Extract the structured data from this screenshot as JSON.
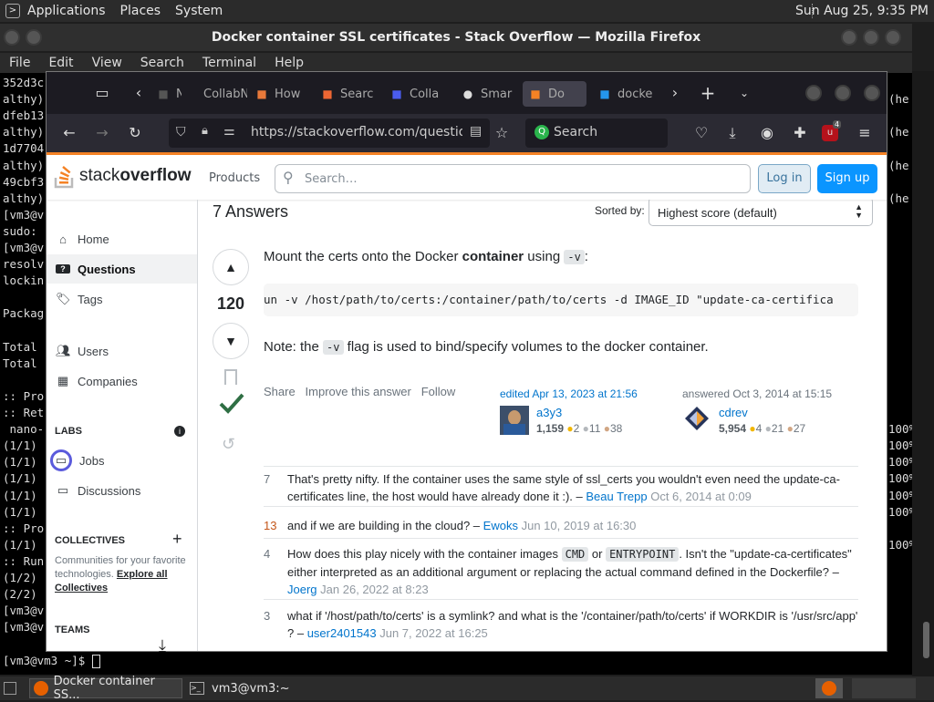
{
  "top_panel": {
    "menus": [
      "Applications",
      "Places",
      "System"
    ],
    "clock": "Sun Aug 25,  9:35 PM"
  },
  "terminal": {
    "title": "Docker container SSL certificates - Stack Overflow — Mozilla Firefox",
    "menu": [
      "File",
      "Edit",
      "View",
      "Search",
      "Terminal",
      "Help"
    ],
    "left_lines": [
      "352d3c",
      "althy)",
      "dfeb13",
      "althy)",
      "1d7704",
      "althy)",
      "49cbf3",
      "althy)",
      "[vm3@v",
      "sudo:",
      "[vm3@v",
      "resolv",
      "lockin",
      "",
      "Packag",
      "",
      "Total",
      "Total",
      "",
      ":: Pro",
      ":: Ret",
      " nano-",
      "(1/1)",
      "(1/1)",
      "(1/1)",
      "(1/1)",
      "(1/1)",
      ":: Pro",
      "(1/1)",
      ":: Run",
      "(1/2)",
      "(2/2)",
      "[vm3@v",
      "[vm3@v"
    ],
    "right_lines": [
      {
        "row": 1,
        "text": "(he"
      },
      {
        "row": 3,
        "text": "(he"
      },
      {
        "row": 5,
        "text": "(he"
      },
      {
        "row": 7,
        "text": "(he"
      },
      {
        "row": 21,
        "text": "100%"
      },
      {
        "row": 22,
        "text": "100%"
      },
      {
        "row": 23,
        "text": "100%"
      },
      {
        "row": 24,
        "text": "100%"
      },
      {
        "row": 25,
        "text": "100%"
      },
      {
        "row": 26,
        "text": "100%"
      },
      {
        "row": 28,
        "text": "100%"
      }
    ],
    "prompt": "[vm3@vm3 ~]$ "
  },
  "firefox": {
    "tabs": [
      {
        "label": "Ne",
        "icon": "blank-icon"
      },
      {
        "label": "CollabNe",
        "icon": "collabnet-icon"
      },
      {
        "label": "How",
        "icon": "howto-icon"
      },
      {
        "label": "Searc",
        "icon": "search-flower-icon"
      },
      {
        "label": "Colla",
        "icon": "collab-q-icon"
      },
      {
        "label": "Smar",
        "icon": "github-icon"
      },
      {
        "label": "Do",
        "icon": "stackoverflow-icon",
        "active": true
      },
      {
        "label": "docke",
        "icon": "docker-icon"
      }
    ],
    "url": "https://stackoverflow.com/questions",
    "search_placeholder": "Search",
    "badge_count": "4"
  },
  "so": {
    "logo_text_light": "stack",
    "logo_text_bold": "overflow",
    "products": "Products",
    "search_placeholder": "Search…",
    "login": "Log in",
    "signup": "Sign up",
    "sidebar": {
      "home": "Home",
      "questions": "Questions",
      "tags": "Tags",
      "users": "Users",
      "companies": "Companies",
      "labs_heading": "LABS",
      "jobs": "Jobs",
      "discussions": "Discussions",
      "collectives_heading": "COLLECTIVES",
      "collectives_desc": "Communities for your favorite technologies.",
      "collectives_link": "Explore all Collectives",
      "teams_heading": "TEAMS"
    },
    "answers_count": "7 Answers",
    "sorted_by_label": "Sorted by:",
    "sort_value": "Highest score (default)",
    "answer": {
      "score": "120",
      "intro_before": "Mount the certs onto the Docker ",
      "intro_bold": "container",
      "intro_after": " using ",
      "intro_code": "-v",
      "intro_end": ":",
      "code_block": "un -v /host/path/to/certs:/container/path/to/certs -d IMAGE_ID \"update-ca-certifica",
      "note_before": "Note: the ",
      "note_code": "-v",
      "note_after": " flag is used to bind/specify volumes to the docker container.",
      "share": "Share",
      "improve": "Improve this answer",
      "follow": "Follow",
      "edited": "edited Apr 13, 2023 at 21:56",
      "editor": {
        "name": "a3y3",
        "rep": "1,159",
        "gold": "2",
        "silver": "11",
        "bronze": "38"
      },
      "answered": "answered Oct 3, 2014 at 15:15",
      "author": {
        "name": "cdrev",
        "rep": "5,954",
        "gold": "4",
        "silver": "21",
        "bronze": "27"
      }
    },
    "comments": [
      {
        "score": "7",
        "text": "That's pretty nifty. If the container uses the same style of ssl_certs you wouldn't even need the update-ca-certificates line, the host would have already done it :). –",
        "user": "Beau Trepp",
        "date": "Oct 6, 2014 at 0:09"
      },
      {
        "score": "13",
        "text": "and if we are building in the cloud? –",
        "user": "Ewoks",
        "date": "Jun 10, 2019 at 16:30"
      },
      {
        "score": "4",
        "text_a": "How does this play nicely with the container images ",
        "code_a": "CMD",
        "text_b": " or ",
        "code_b": "ENTRYPOINT",
        "text_c": ". Isn't the \"update-ca-certificates\" either interpreted as an additional argument or replacing the actual command defined in the Dockerfile? –",
        "user": "Joerg",
        "date": "Jan 26, 2022 at 8:23"
      },
      {
        "score": "3",
        "text": "what if '/host/path/to/certs' is a symlink? and what is the '/container/path/to/certs' if WORKDIR is '/usr/src/app' ? –",
        "user": "user2401543",
        "date": "Jun 7, 2022 at 16:25"
      }
    ]
  },
  "taskbar": {
    "firefox_task": "Docker container SS...",
    "terminal_task": "vm3@vm3:~"
  }
}
